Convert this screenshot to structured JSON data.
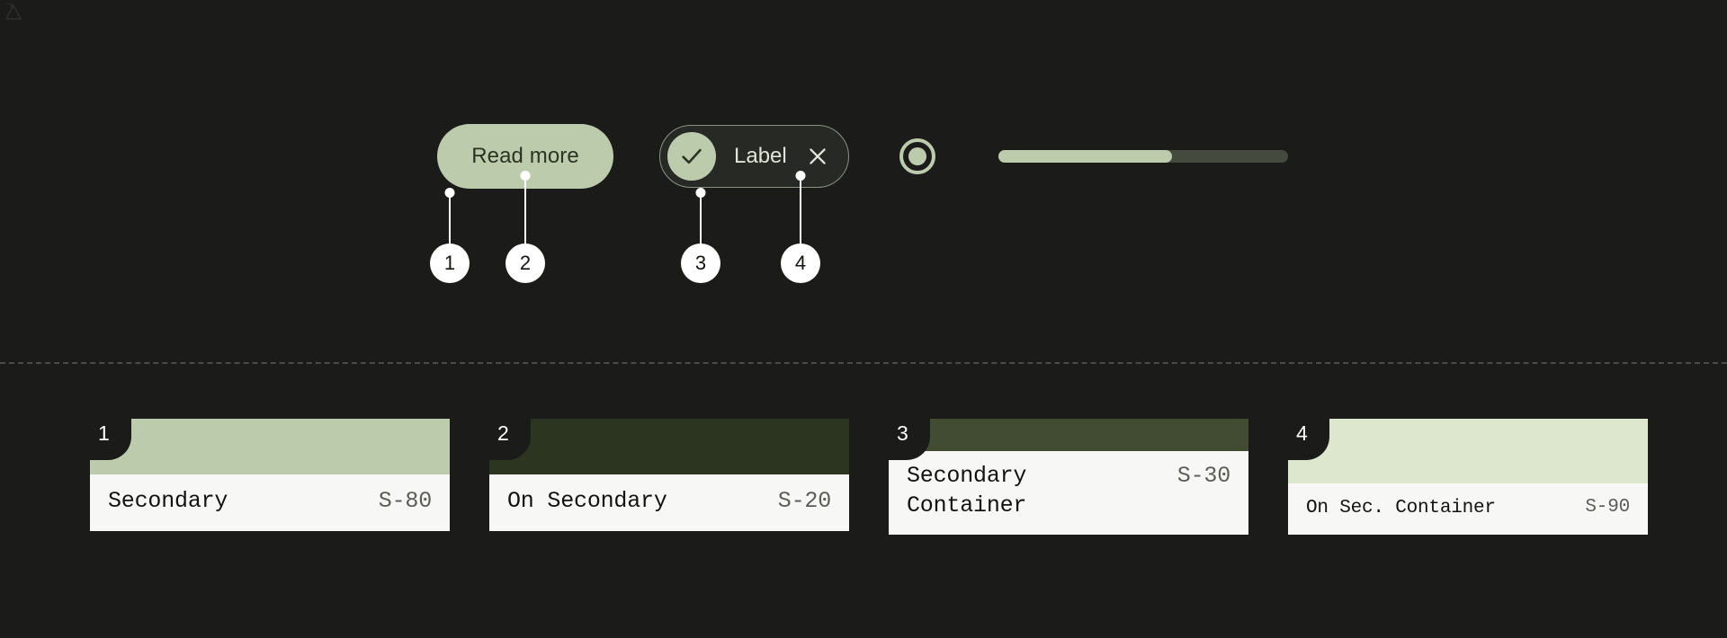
{
  "theme": {
    "background": "#1b1c19",
    "accent": "#bdcbad",
    "on_accent": "#2b3420",
    "callout_fill": "#ffffff",
    "card_body_bg": "#f7f7f5",
    "divider_color": "#4a4c46"
  },
  "components": {
    "button": {
      "label": "Read more",
      "bg": "#bdcbad",
      "text_color": "#2b3420"
    },
    "chip": {
      "label": "Label",
      "leading_icon": "check-icon",
      "trailing_icon": "close-icon",
      "border_color": "#8a9383",
      "avatar_bg": "#bdcbad"
    },
    "radio": {
      "name": "radio-button",
      "selected": true,
      "color": "#bdcbad"
    },
    "slider": {
      "name": "slider",
      "value_percent": 60,
      "track_color": "#454a3f",
      "fill_color": "#bdcbad"
    }
  },
  "callouts": [
    {
      "number": "1",
      "target": "button-container-color"
    },
    {
      "number": "2",
      "target": "button-label-color"
    },
    {
      "number": "3",
      "target": "chip-avatar-color"
    },
    {
      "number": "4",
      "target": "chip-trailing-icon-color"
    }
  ],
  "swatches": [
    {
      "badge": "1",
      "name": "Secondary",
      "token": "S-80",
      "color": "#bdcbad",
      "swatch_height": 62,
      "lines": 1
    },
    {
      "badge": "2",
      "name": "On Secondary",
      "token": "S-20",
      "color": "#2c3520",
      "swatch_height": 62,
      "lines": 1
    },
    {
      "badge": "3",
      "name": "Secondary\nContainer",
      "token": "S-30",
      "color": "#414c33",
      "swatch_height": 36,
      "lines": 2
    },
    {
      "badge": "4",
      "name": "On Sec. Container",
      "token": "S-90",
      "color": "#dce7ce",
      "swatch_height": 72,
      "lines": 1
    }
  ]
}
